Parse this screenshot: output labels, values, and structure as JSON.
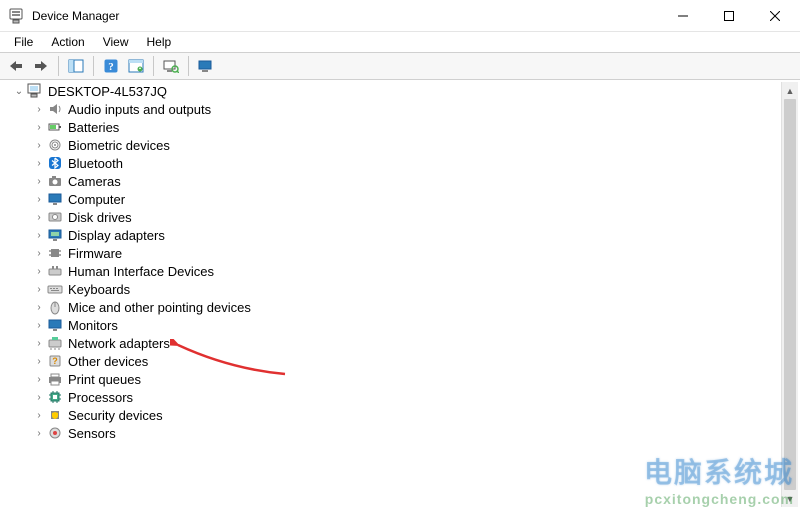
{
  "window": {
    "title": "Device Manager"
  },
  "menu": {
    "file": "File",
    "action": "Action",
    "view": "View",
    "help": "Help"
  },
  "tree": {
    "root": {
      "label": "DESKTOP-4L537JQ",
      "expanded": true
    },
    "items": [
      {
        "label": "Audio inputs and outputs"
      },
      {
        "label": "Batteries"
      },
      {
        "label": "Biometric devices"
      },
      {
        "label": "Bluetooth"
      },
      {
        "label": "Cameras"
      },
      {
        "label": "Computer"
      },
      {
        "label": "Disk drives"
      },
      {
        "label": "Display adapters"
      },
      {
        "label": "Firmware"
      },
      {
        "label": "Human Interface Devices"
      },
      {
        "label": "Keyboards"
      },
      {
        "label": "Mice and other pointing devices"
      },
      {
        "label": "Monitors"
      },
      {
        "label": "Network adapters"
      },
      {
        "label": "Other devices"
      },
      {
        "label": "Print queues"
      },
      {
        "label": "Processors"
      },
      {
        "label": "Security devices"
      },
      {
        "label": "Sensors"
      }
    ]
  },
  "watermark": {
    "cn": "电脑系统城",
    "url": "pcxitongcheng.com"
  }
}
